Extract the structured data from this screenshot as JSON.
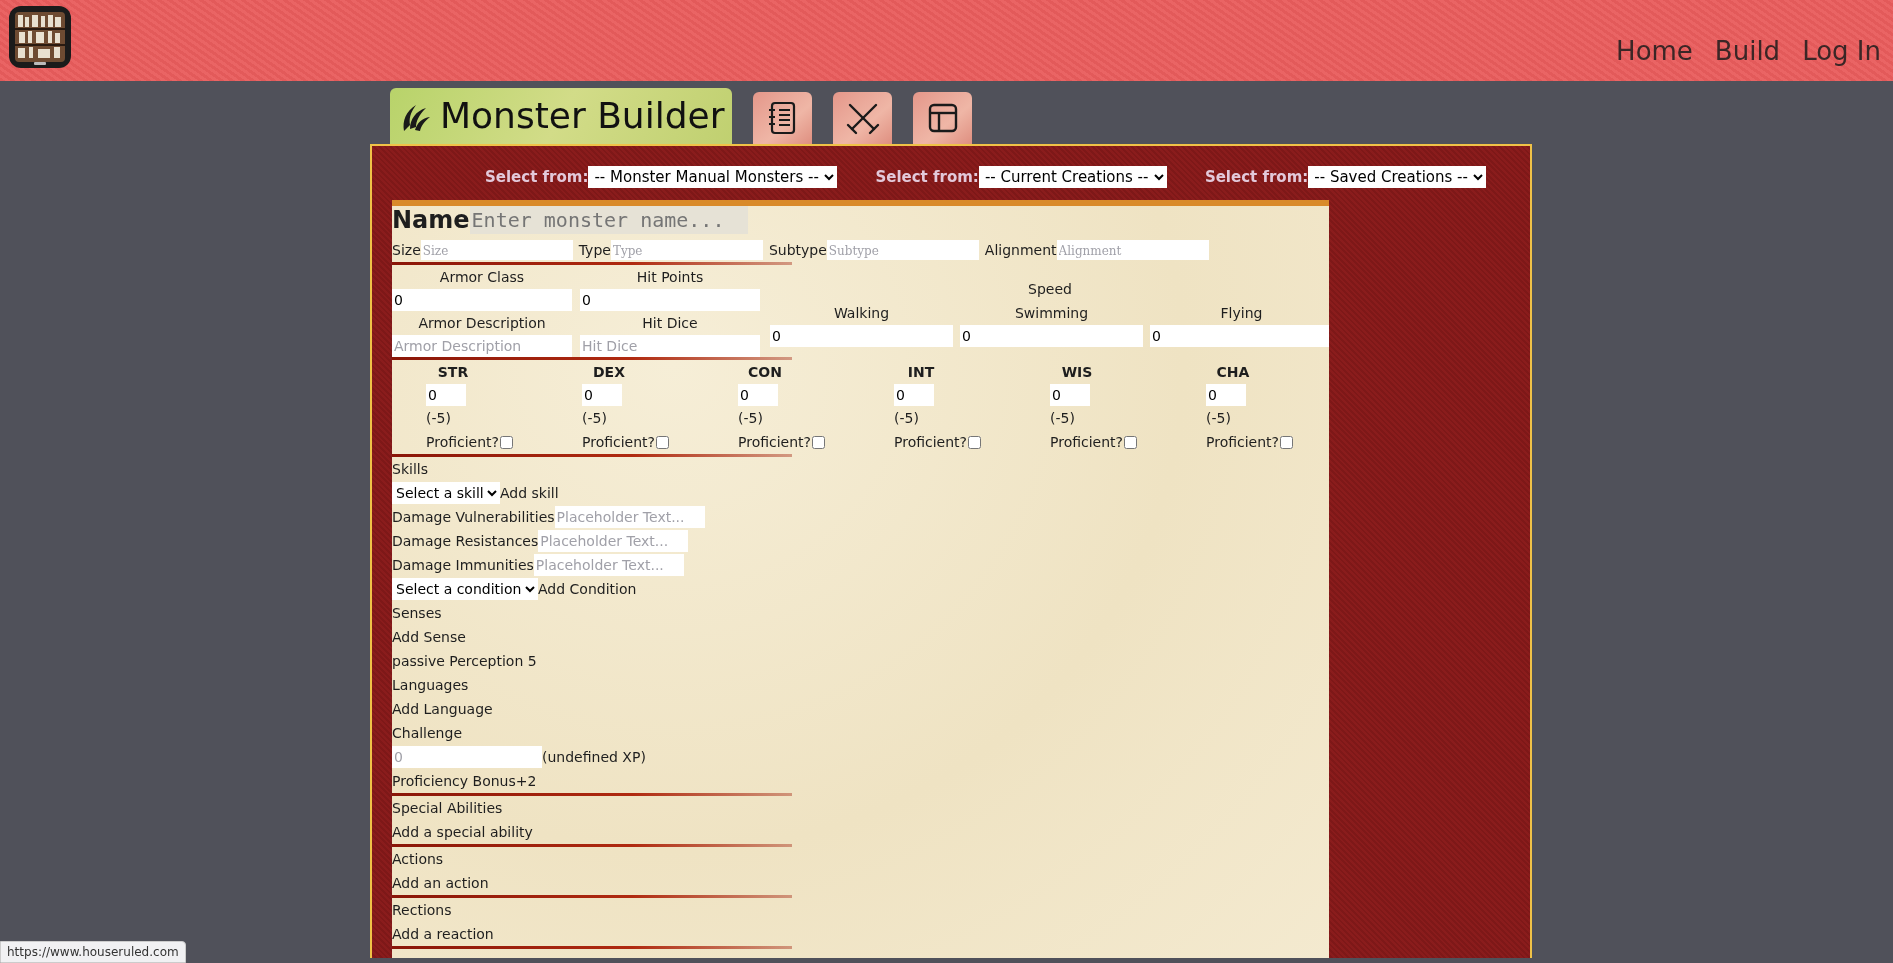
{
  "header": {
    "nav": [
      {
        "label": "Home"
      },
      {
        "label": "Build"
      },
      {
        "label": "Log In"
      }
    ]
  },
  "tabs": [
    {
      "kind": "title",
      "label": "Monster Builder",
      "selected": true
    },
    {
      "kind": "icon",
      "selected": false
    },
    {
      "kind": "icon",
      "selected": false
    },
    {
      "kind": "icon",
      "selected": false
    }
  ],
  "select_bar": [
    {
      "label": "Select from:",
      "value": "-- Monster Manual Monsters --"
    },
    {
      "label": "Select from:",
      "value": "-- Current Creations --"
    },
    {
      "label": "Select from:",
      "value": "-- Saved Creations --"
    }
  ],
  "name": {
    "label": "Name",
    "placeholder": "Enter monster name..."
  },
  "basic_fields": [
    {
      "label": "Size",
      "placeholder": "Size"
    },
    {
      "label": "Type",
      "placeholder": "Type"
    },
    {
      "label": "Subtype",
      "placeholder": "Subtype"
    },
    {
      "label": "Alignment",
      "placeholder": "Alignment"
    }
  ],
  "armor": [
    {
      "label": "Armor Class",
      "value": "0"
    },
    {
      "label": "Hit Points",
      "value": "0"
    },
    {
      "label": "Armor Description",
      "placeholder": "Armor Description"
    },
    {
      "label": "Hit Dice",
      "placeholder": "Hit Dice"
    }
  ],
  "speed": {
    "title": "Speed",
    "fields": [
      {
        "label": "Walking",
        "value": "0"
      },
      {
        "label": "Swimming",
        "value": "0"
      },
      {
        "label": "Flying",
        "value": "0"
      }
    ]
  },
  "abilities": [
    {
      "name": "STR",
      "value": "0",
      "modifier": "(-5)",
      "proficient_label": "Proficient?",
      "checked": false
    },
    {
      "name": "DEX",
      "value": "0",
      "modifier": "(-5)",
      "proficient_label": "Proficient?",
      "checked": false
    },
    {
      "name": "CON",
      "value": "0",
      "modifier": "(-5)",
      "proficient_label": "Proficient?",
      "checked": false
    },
    {
      "name": "INT",
      "value": "0",
      "modifier": "(-5)",
      "proficient_label": "Proficient?",
      "checked": false
    },
    {
      "name": "WIS",
      "value": "0",
      "modifier": "(-5)",
      "proficient_label": "Proficient?",
      "checked": false
    },
    {
      "name": "CHA",
      "value": "0",
      "modifier": "(-5)",
      "proficient_label": "Proficient?",
      "checked": false
    }
  ],
  "sections": [
    [
      {
        "kind": "text",
        "text": "Skills"
      },
      {
        "kind": "select",
        "value": "Select a skill",
        "action": "Add skill"
      },
      {
        "kind": "field",
        "label": "Damage Vulnerabilities",
        "placeholder": "Placeholder Text..."
      },
      {
        "kind": "field",
        "label": "Damage Resistances",
        "placeholder": "Placeholder Text..."
      },
      {
        "kind": "field",
        "label": "Damage Immunities",
        "placeholder": "Placeholder Text..."
      },
      {
        "kind": "select",
        "value": "Select a condition",
        "action": "Add Condition"
      },
      {
        "kind": "text",
        "text": "Senses"
      },
      {
        "kind": "text",
        "text": "Add Sense"
      },
      {
        "kind": "text",
        "text": "passive Perception 5"
      },
      {
        "kind": "text",
        "text": "Languages"
      },
      {
        "kind": "text",
        "text": "Add Language"
      },
      {
        "kind": "text",
        "text": "Challenge"
      },
      {
        "kind": "challenge",
        "placeholder": "0",
        "note": "(undefined XP)"
      },
      {
        "kind": "text",
        "text": "Proficiency Bonus+2"
      }
    ],
    [
      {
        "kind": "text",
        "text": "Special Abilities"
      },
      {
        "kind": "text",
        "text": "Add a special ability"
      }
    ],
    [
      {
        "kind": "text",
        "text": "Actions"
      },
      {
        "kind": "text",
        "text": "Add an action"
      }
    ],
    [
      {
        "kind": "text",
        "text": "Rections"
      },
      {
        "kind": "text",
        "text": "Add a reaction"
      }
    ]
  ],
  "status_bubble": "https://www.houseruled.com"
}
